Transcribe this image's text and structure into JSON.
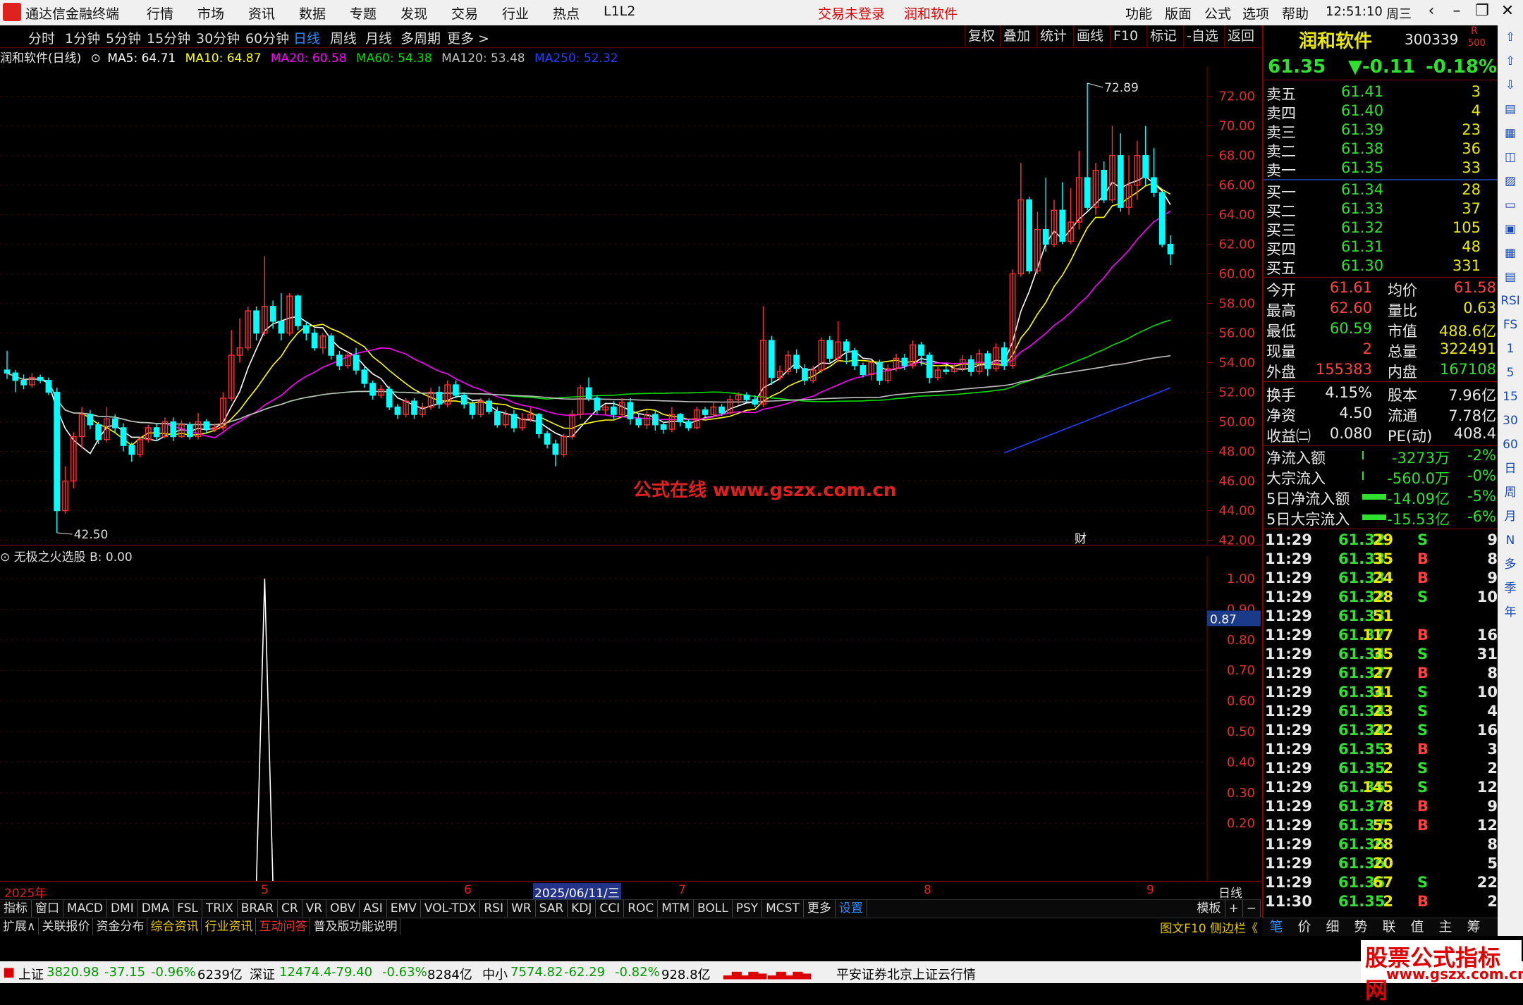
{
  "menubar": {
    "app": "通达信金融终端",
    "items": [
      "行情",
      "市场",
      "资讯",
      "数据",
      "专题",
      "发现",
      "交易",
      "行业",
      "热点",
      "L1L2"
    ],
    "login": "交易未登录",
    "stock": "润和软件",
    "right_items": [
      "功能",
      "版面",
      "公式",
      "选项",
      "帮助"
    ],
    "time": "12:51:10",
    "weekday": "周三"
  },
  "periods": [
    "分时",
    "1分钟",
    "5分钟",
    "15分钟",
    "30分钟",
    "60分钟",
    "日线",
    "周线",
    "月线",
    "多周期",
    "更多 >"
  ],
  "active_period": "日线",
  "toolbar": [
    "复权",
    "叠加",
    "统计",
    "画线",
    "F10",
    "标记",
    "-自选",
    "返回"
  ],
  "ma_line": {
    "title": "润和软件(日线)",
    "ma5": "MA5: 64.71",
    "ma10": "MA10: 64.87",
    "ma20": "MA20: 60.58",
    "ma60": "MA60: 54.38",
    "ma120": "MA120: 53.48",
    "ma250": "MA250: 52.32"
  },
  "chart_data": [
    {
      "type": "candlestick",
      "title": "润和软件(日线)",
      "ylim": [
        42,
        73
      ],
      "yticks": [
        72,
        70,
        68,
        66,
        64,
        62,
        60,
        58,
        56,
        54,
        52,
        50,
        48,
        46,
        44,
        42
      ],
      "annotations": {
        "high": "72.89",
        "low": "42.50",
        "watermark": "公式在线  www.gszx.com.cn",
        "fin_tag": "财"
      },
      "x_labels": [
        "2025年",
        "5",
        "6",
        "2025/06/11/三",
        "7",
        "8",
        "9"
      ],
      "candles": [
        [
          53.5,
          53.3,
          54.8,
          52.9
        ],
        [
          53.3,
          52.8,
          53.5,
          52.0
        ],
        [
          52.8,
          52.5,
          53.2,
          52.2
        ],
        [
          52.5,
          53.0,
          53.3,
          52.3
        ],
        [
          53.0,
          52.8,
          53.2,
          52.6
        ],
        [
          52.8,
          52.0,
          53.0,
          51.8
        ],
        [
          52.0,
          44.0,
          52.3,
          42.5
        ],
        [
          44.0,
          46.0,
          47.0,
          43.8
        ],
        [
          46.0,
          49.0,
          49.3,
          45.5
        ],
        [
          49.0,
          50.5,
          51.0,
          48.2
        ],
        [
          50.5,
          49.8,
          50.8,
          49.5
        ],
        [
          49.8,
          48.8,
          50.0,
          48.5
        ],
        [
          48.8,
          50.2,
          51.0,
          48.6
        ],
        [
          50.2,
          49.6,
          50.5,
          49.3
        ],
        [
          49.6,
          48.4,
          49.9,
          48.0
        ],
        [
          48.4,
          47.8,
          48.6,
          47.3
        ],
        [
          47.8,
          48.8,
          49.0,
          47.6
        ],
        [
          48.8,
          49.6,
          49.8,
          48.6
        ],
        [
          49.6,
          49.0,
          49.9,
          48.7
        ],
        [
          49.0,
          50.0,
          50.3,
          48.9
        ],
        [
          50.0,
          49.0,
          50.3,
          48.7
        ],
        [
          49.0,
          49.8,
          50.1,
          48.9
        ],
        [
          49.8,
          49.0,
          50.0,
          48.8
        ],
        [
          49.0,
          50.0,
          50.6,
          48.8
        ],
        [
          50.0,
          49.5,
          50.2,
          49.2
        ],
        [
          49.5,
          49.6,
          49.9,
          49.3
        ],
        [
          49.6,
          51.6,
          52.0,
          49.4
        ],
        [
          51.6,
          54.5,
          56.2,
          51.4
        ],
        [
          54.5,
          55.0,
          57.0,
          54.0
        ],
        [
          55.0,
          57.5,
          57.8,
          54.8
        ],
        [
          57.5,
          56.0,
          57.8,
          55.5
        ],
        [
          56.0,
          57.8,
          61.2,
          55.8
        ],
        [
          57.8,
          56.8,
          58.2,
          56.3
        ],
        [
          56.8,
          56.0,
          58.7,
          55.5
        ],
        [
          56.0,
          58.5,
          58.7,
          55.8
        ],
        [
          58.5,
          56.5,
          58.6,
          56.2
        ],
        [
          56.5,
          56.0,
          56.8,
          55.5
        ],
        [
          56.0,
          55.0,
          56.3,
          54.8
        ],
        [
          55.0,
          55.8,
          56.0,
          54.6
        ],
        [
          55.8,
          54.5,
          56.0,
          54.2
        ],
        [
          54.5,
          53.8,
          54.8,
          53.5
        ],
        [
          53.8,
          54.5,
          54.8,
          53.6
        ],
        [
          54.5,
          53.5,
          55.0,
          53.2
        ],
        [
          53.5,
          52.6,
          53.7,
          52.3
        ],
        [
          52.6,
          51.8,
          52.8,
          51.5
        ],
        [
          51.8,
          52.2,
          52.5,
          51.6
        ],
        [
          52.2,
          51.0,
          52.4,
          50.8
        ],
        [
          51.0,
          50.5,
          51.2,
          50.2
        ],
        [
          50.5,
          51.4,
          51.6,
          50.3
        ],
        [
          51.4,
          50.5,
          51.6,
          50.2
        ],
        [
          50.5,
          51.0,
          51.3,
          50.3
        ],
        [
          51.0,
          52.0,
          52.3,
          50.8
        ],
        [
          52.0,
          51.2,
          52.4,
          50.9
        ],
        [
          51.2,
          52.5,
          52.8,
          51.0
        ],
        [
          52.5,
          51.8,
          52.8,
          51.6
        ],
        [
          51.8,
          51.2,
          52.0,
          50.9
        ],
        [
          51.2,
          50.5,
          51.4,
          50.2
        ],
        [
          50.5,
          51.4,
          51.6,
          50.3
        ],
        [
          51.4,
          50.7,
          51.6,
          50.5
        ],
        [
          50.7,
          49.8,
          51.0,
          49.6
        ],
        [
          49.8,
          50.5,
          50.8,
          49.6
        ],
        [
          50.5,
          49.6,
          50.8,
          49.3
        ],
        [
          49.6,
          50.2,
          50.6,
          49.4
        ],
        [
          50.2,
          50.5,
          51.0,
          50.0
        ],
        [
          50.5,
          49.2,
          50.6,
          48.9
        ],
        [
          49.2,
          48.5,
          49.4,
          48.2
        ],
        [
          48.5,
          47.8,
          48.8,
          47.0
        ],
        [
          47.8,
          49.0,
          49.2,
          47.6
        ],
        [
          49.0,
          50.5,
          50.8,
          48.8
        ],
        [
          50.5,
          52.3,
          52.5,
          50.2
        ],
        [
          52.3,
          51.6,
          53.0,
          51.4
        ],
        [
          51.6,
          50.8,
          51.8,
          50.5
        ],
        [
          50.8,
          51.0,
          51.2,
          50.5
        ],
        [
          51.0,
          50.5,
          51.4,
          50.2
        ],
        [
          50.5,
          51.3,
          51.6,
          50.3
        ],
        [
          51.3,
          50.2,
          51.6,
          49.8
        ],
        [
          50.2,
          49.8,
          50.6,
          49.6
        ],
        [
          49.8,
          50.5,
          50.8,
          49.5
        ],
        [
          50.5,
          49.8,
          50.8,
          49.4
        ],
        [
          49.8,
          49.5,
          50.0,
          49.2
        ],
        [
          49.5,
          50.5,
          51.0,
          49.3
        ],
        [
          50.5,
          50.0,
          50.6,
          49.7
        ],
        [
          50.0,
          49.6,
          50.2,
          49.4
        ],
        [
          49.6,
          50.8,
          51.0,
          49.5
        ],
        [
          50.8,
          50.5,
          51.0,
          50.3
        ],
        [
          50.5,
          51.0,
          51.3,
          50.4
        ],
        [
          51.0,
          50.6,
          51.2,
          50.4
        ],
        [
          50.6,
          51.5,
          51.8,
          50.5
        ],
        [
          51.5,
          51.8,
          52.0,
          51.2
        ],
        [
          51.8,
          51.5,
          52.0,
          51.3
        ],
        [
          51.5,
          51.2,
          51.8,
          51.0
        ],
        [
          51.2,
          55.5,
          57.8,
          51.0
        ],
        [
          55.5,
          53.0,
          55.8,
          52.5
        ],
        [
          53.0,
          53.4,
          53.8,
          52.8
        ],
        [
          53.4,
          54.5,
          54.8,
          53.2
        ],
        [
          54.5,
          53.6,
          54.9,
          53.3
        ],
        [
          53.6,
          52.8,
          53.9,
          52.5
        ],
        [
          52.8,
          53.5,
          53.8,
          52.6
        ],
        [
          53.5,
          55.5,
          55.7,
          53.3
        ],
        [
          55.5,
          54.3,
          55.8,
          54.0
        ],
        [
          54.3,
          55.4,
          56.8,
          54.0
        ],
        [
          55.4,
          54.8,
          55.6,
          53.9
        ],
        [
          54.8,
          53.8,
          55.0,
          53.5
        ],
        [
          53.8,
          53.2,
          54.0,
          53.0
        ],
        [
          53.2,
          54.0,
          54.2,
          52.8
        ],
        [
          54.0,
          52.8,
          54.2,
          52.5
        ],
        [
          52.8,
          53.6,
          53.9,
          52.6
        ],
        [
          53.6,
          54.3,
          54.6,
          53.4
        ],
        [
          54.3,
          53.8,
          54.6,
          53.5
        ],
        [
          53.8,
          55.2,
          55.5,
          53.6
        ],
        [
          55.2,
          54.5,
          55.4,
          53.8
        ],
        [
          54.5,
          53.0,
          54.7,
          52.6
        ],
        [
          53.0,
          53.5,
          53.7,
          52.8
        ],
        [
          53.5,
          53.4,
          53.8,
          53.2
        ],
        [
          53.4,
          53.6,
          53.9,
          53.3
        ],
        [
          53.6,
          54.2,
          54.5,
          53.4
        ],
        [
          54.2,
          53.4,
          54.5,
          53.1
        ],
        [
          53.4,
          54.6,
          54.9,
          53.2
        ],
        [
          54.6,
          53.6,
          54.8,
          53.1
        ],
        [
          53.6,
          55.0,
          55.3,
          53.4
        ],
        [
          55.0,
          53.8,
          55.4,
          53.5
        ],
        [
          53.8,
          60.0,
          60.3,
          53.6
        ],
        [
          60.0,
          65.0,
          67.5,
          59.8
        ],
        [
          65.0,
          60.2,
          65.2,
          60.0
        ],
        [
          60.2,
          63.0,
          64.2,
          60.0
        ],
        [
          63.0,
          62.0,
          66.5,
          61.5
        ],
        [
          62.0,
          64.3,
          65.0,
          61.8
        ],
        [
          64.3,
          62.2,
          66.2,
          62.0
        ],
        [
          62.2,
          63.5,
          65.8,
          62.0
        ],
        [
          63.5,
          66.5,
          68.3,
          63.0
        ],
        [
          66.5,
          64.5,
          72.89,
          64.3
        ],
        [
          64.5,
          67.0,
          67.5,
          64.0
        ],
        [
          67.0,
          65.0,
          67.6,
          64.8
        ],
        [
          65.0,
          68.0,
          70.0,
          64.8
        ],
        [
          68.0,
          64.5,
          69.5,
          64.2
        ],
        [
          64.5,
          66.0,
          68.0,
          64.0
        ],
        [
          66.0,
          68.0,
          69.0,
          65.0
        ],
        [
          68.0,
          66.5,
          70.0,
          66.0
        ],
        [
          66.5,
          65.5,
          68.5,
          65.2
        ],
        [
          65.5,
          62.0,
          65.5,
          61.8
        ],
        [
          62.0,
          61.35,
          62.6,
          60.59
        ]
      ]
    },
    {
      "type": "line",
      "title": "无极之火选股",
      "series_name": "B: 0.00",
      "cursor_value": "0.87",
      "ylim": [
        0,
        1
      ],
      "yticks": [
        "1.00",
        "0.90",
        "0.80",
        "0.70",
        "0.60",
        "0.50",
        "0.40",
        "0.30",
        "0.20"
      ],
      "spike_index": 31,
      "spike_value": 1.0
    }
  ],
  "indicators": [
    "指标",
    "窗口",
    "MACD",
    "DMI",
    "DMA",
    "FSL",
    "TRIX",
    "BRAR",
    "CR",
    "VR",
    "OBV",
    "ASI",
    "EMV",
    "VOL-TDX",
    "RSI",
    "WR",
    "SAR",
    "KDJ",
    "CCI",
    "ROC",
    "MTM",
    "BOLL",
    "PSY",
    "MCST",
    "更多",
    "设置"
  ],
  "indbar_right": [
    "模板",
    "+",
    "−"
  ],
  "extbar": [
    "扩展∧",
    "关联报价",
    "资金分布",
    "综合资讯",
    "行业资讯",
    "互动问答",
    "普及版功能说明"
  ],
  "extbar_right": "图文F10 侧边栏《",
  "right_tabs": [
    "笔",
    "价",
    "细",
    "势",
    "联",
    "值",
    "主",
    "筹"
  ],
  "quote": {
    "name": "润和软件",
    "code": "300339",
    "badge_top": "R",
    "badge_bottom": "500",
    "price": "61.35",
    "change": "▼-0.11",
    "pct": "-0.18%",
    "asks": [
      [
        "卖五",
        "61.41",
        "3"
      ],
      [
        "卖四",
        "61.40",
        "4"
      ],
      [
        "卖三",
        "61.39",
        "23"
      ],
      [
        "卖二",
        "61.38",
        "36"
      ],
      [
        "卖一",
        "61.35",
        "33"
      ]
    ],
    "bids": [
      [
        "买一",
        "61.34",
        "28"
      ],
      [
        "买二",
        "61.33",
        "37"
      ],
      [
        "买三",
        "61.32",
        "105"
      ],
      [
        "买四",
        "61.31",
        "48"
      ],
      [
        "买五",
        "61.30",
        "331"
      ]
    ],
    "stats": [
      [
        "今开",
        "61.61",
        "均价",
        "61.58"
      ],
      [
        "最高",
        "62.60",
        "量比",
        "0.63"
      ],
      [
        "最低",
        "60.59",
        "市值",
        "488.6亿"
      ],
      [
        "现量",
        "2",
        "总量",
        "322491"
      ],
      [
        "外盘",
        "155383",
        "内盘",
        "167108"
      ]
    ],
    "stats2": [
      [
        "换手",
        "4.15%",
        "股本",
        "7.96亿"
      ],
      [
        "净资",
        "4.50",
        "流通",
        "7.78亿"
      ],
      [
        "收益㈡",
        "0.080",
        "PE(动)",
        "408.4"
      ]
    ],
    "flows": [
      [
        "净流入额",
        "-3273万",
        "-2%"
      ],
      [
        "大宗流入",
        "-560.0万",
        "-0%"
      ],
      [
        "5日净流入额",
        "-14.09亿",
        "-5%"
      ],
      [
        "5日大宗流入",
        "-15.53亿",
        "-6%"
      ]
    ],
    "ticks": [
      [
        "11:29",
        "61.32",
        "29",
        "S",
        "9"
      ],
      [
        "11:29",
        "61.33",
        "35",
        "B",
        "8"
      ],
      [
        "11:29",
        "61.33",
        "24",
        "B",
        "9"
      ],
      [
        "11:29",
        "61.32",
        "28",
        "S",
        "10"
      ],
      [
        "11:29",
        "61.33",
        "51",
        "",
        ""
      ],
      [
        "11:29",
        "61.37",
        "117",
        "B",
        "16"
      ],
      [
        "11:29",
        "61.34",
        "35",
        "S",
        "31"
      ],
      [
        "11:29",
        "61.37",
        "27",
        "B",
        "8"
      ],
      [
        "11:29",
        "61.34",
        "31",
        "S",
        "10"
      ],
      [
        "11:29",
        "61.34",
        "23",
        "S",
        "4"
      ],
      [
        "11:29",
        "61.34",
        "22",
        "S",
        "16"
      ],
      [
        "11:29",
        "61.35",
        "3",
        "B",
        "3"
      ],
      [
        "11:29",
        "61.35",
        "2",
        "S",
        "2"
      ],
      [
        "11:29",
        "61.35",
        "145",
        "S",
        "12"
      ],
      [
        "11:29",
        "61.37",
        "8",
        "B",
        "9"
      ],
      [
        "11:29",
        "61.37",
        "55",
        "B",
        "12"
      ],
      [
        "11:29",
        "61.36",
        "28",
        "",
        "8"
      ],
      [
        "11:29",
        "61.36",
        "20",
        "",
        "5"
      ],
      [
        "11:29",
        "61.35",
        "67",
        "S",
        "22"
      ],
      [
        "11:30",
        "61.35",
        "2",
        "B",
        "2"
      ]
    ]
  },
  "sidebar": [
    "RSI",
    "FS",
    "1",
    "5",
    "15",
    "30",
    "60",
    "日",
    "周",
    "月",
    "N",
    "多",
    "季",
    "年"
  ],
  "status": {
    "sh_name": "上证",
    "sh": "3820.98",
    "sh_chg": "-37.15",
    "sh_pct": "-0.96%",
    "sh_amt": "6239亿",
    "sz_name": "深证",
    "sz": "12474.4",
    "sz_chg": "-79.40",
    "sz_pct": "-0.63%",
    "sz_amt": "8284亿",
    "zx_name": "中小",
    "zx": "7574.82",
    "zx_chg": "-62.29",
    "zx_pct": "-0.82%",
    "zx_amt": "928.8亿",
    "broker": "平安证券北京上证云行情"
  },
  "watermark": {
    "line1": "股票公式指标网",
    "line2": "www.gszx.com.cn"
  },
  "colors": {
    "up": "#ff3232",
    "down": "#00ffff",
    "ma5": "#ffffff",
    "ma10": "#ffff00",
    "ma20": "#ff00ff",
    "ma60": "#00dd00",
    "ma120": "#c0c0c0",
    "ma250": "#2040ff",
    "grid": "#8b0000"
  }
}
